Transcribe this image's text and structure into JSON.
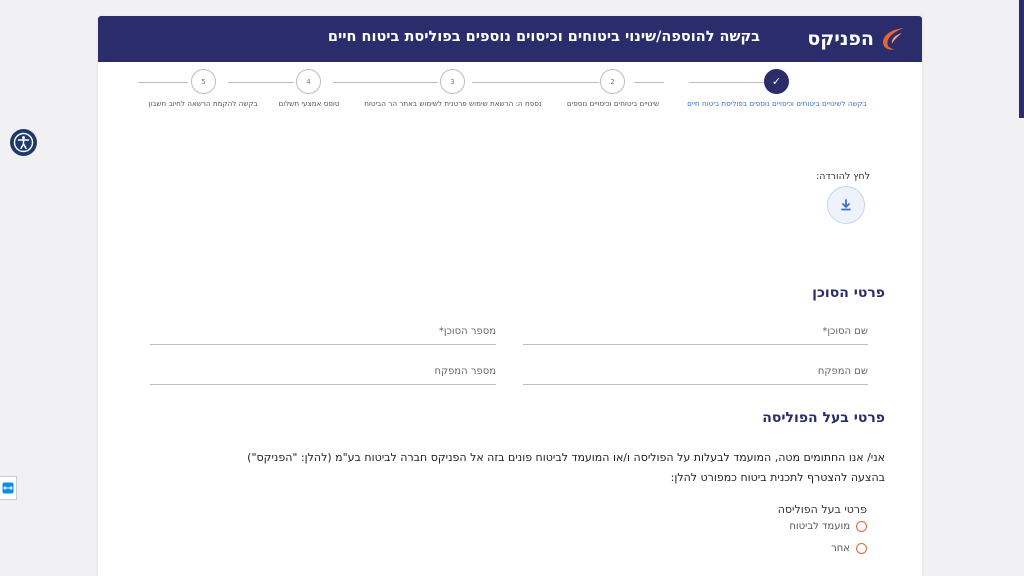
{
  "header": {
    "logo_text": "הפניקס",
    "title": "בקשה להוספה/שינוי ביטוחים וכיסוים נוספים בפוליסת ביטוח חיים"
  },
  "steps": [
    {
      "label": "בקשה לשינויים ביטוחים וכיסויים נוספים בפוליסת ביטוח חיים",
      "number": "✓",
      "active": true
    },
    {
      "label": "שינויים ביטוחים וכיסויים נוספים",
      "number": "2",
      "active": false
    },
    {
      "label": "נספח ה: הרשאת שימוש פרטנית לשימוש באתר הר הביטוח",
      "number": "3",
      "active": false
    },
    {
      "label": "טופס אמצעי תשלום",
      "number": "4",
      "active": false
    },
    {
      "label": "בקשה להקמת הרשאה לחיוב חשבון",
      "number": "5",
      "active": false
    }
  ],
  "download": {
    "label": "לחץ להורדה:",
    "icon": "download-icon"
  },
  "agent_section": {
    "title": "פרטי הסוכן",
    "agent_name_placeholder": "שם הסוכן*",
    "agent_number_placeholder": "מספר הסוכן*",
    "supervisor_name_placeholder": "שם המפקח",
    "supervisor_number_placeholder": "מספר המפקח"
  },
  "policy_owner_section": {
    "title": "פרטי בעל הפוליסה",
    "paragraph_line1": "אני/ אנו החתומים מטה, המועמד לבעלות על הפוליסה ו/או המועמד לביטוח פונים בזה אל הפניקס חברה לביטוח בע\"מ (להלן: \"הפניקס\")",
    "paragraph_line2": "בהצעה להצטרף לתכנית ביטוח כמפורט להלן:",
    "subheading": "פרטי בעל הפוליסה",
    "options": [
      "מועמד לביטוח",
      "אחר"
    ]
  },
  "colors": {
    "brand": "#2a2c6b",
    "accent": "#e0673a",
    "link": "#3b6fd6"
  }
}
